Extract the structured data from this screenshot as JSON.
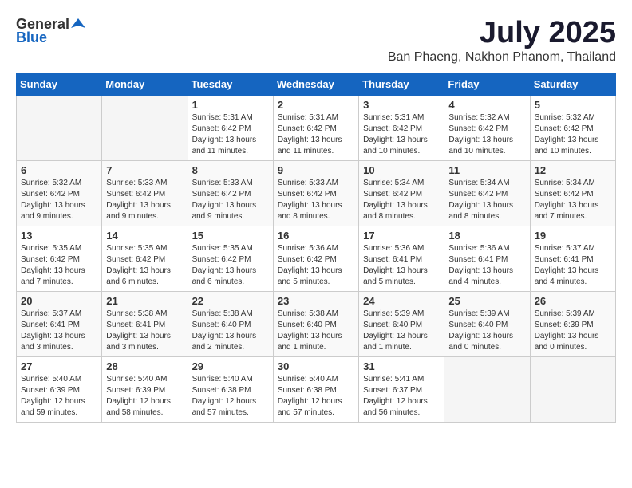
{
  "app": {
    "logo_general": "General",
    "logo_blue": "Blue",
    "title": "July 2025",
    "subtitle": "Ban Phaeng, Nakhon Phanom, Thailand"
  },
  "calendar": {
    "headers": [
      "Sunday",
      "Monday",
      "Tuesday",
      "Wednesday",
      "Thursday",
      "Friday",
      "Saturday"
    ],
    "weeks": [
      [
        {
          "day": "",
          "info": ""
        },
        {
          "day": "",
          "info": ""
        },
        {
          "day": "1",
          "info": "Sunrise: 5:31 AM\nSunset: 6:42 PM\nDaylight: 13 hours and 11 minutes."
        },
        {
          "day": "2",
          "info": "Sunrise: 5:31 AM\nSunset: 6:42 PM\nDaylight: 13 hours and 11 minutes."
        },
        {
          "day": "3",
          "info": "Sunrise: 5:31 AM\nSunset: 6:42 PM\nDaylight: 13 hours and 10 minutes."
        },
        {
          "day": "4",
          "info": "Sunrise: 5:32 AM\nSunset: 6:42 PM\nDaylight: 13 hours and 10 minutes."
        },
        {
          "day": "5",
          "info": "Sunrise: 5:32 AM\nSunset: 6:42 PM\nDaylight: 13 hours and 10 minutes."
        }
      ],
      [
        {
          "day": "6",
          "info": "Sunrise: 5:32 AM\nSunset: 6:42 PM\nDaylight: 13 hours and 9 minutes."
        },
        {
          "day": "7",
          "info": "Sunrise: 5:33 AM\nSunset: 6:42 PM\nDaylight: 13 hours and 9 minutes."
        },
        {
          "day": "8",
          "info": "Sunrise: 5:33 AM\nSunset: 6:42 PM\nDaylight: 13 hours and 9 minutes."
        },
        {
          "day": "9",
          "info": "Sunrise: 5:33 AM\nSunset: 6:42 PM\nDaylight: 13 hours and 8 minutes."
        },
        {
          "day": "10",
          "info": "Sunrise: 5:34 AM\nSunset: 6:42 PM\nDaylight: 13 hours and 8 minutes."
        },
        {
          "day": "11",
          "info": "Sunrise: 5:34 AM\nSunset: 6:42 PM\nDaylight: 13 hours and 8 minutes."
        },
        {
          "day": "12",
          "info": "Sunrise: 5:34 AM\nSunset: 6:42 PM\nDaylight: 13 hours and 7 minutes."
        }
      ],
      [
        {
          "day": "13",
          "info": "Sunrise: 5:35 AM\nSunset: 6:42 PM\nDaylight: 13 hours and 7 minutes."
        },
        {
          "day": "14",
          "info": "Sunrise: 5:35 AM\nSunset: 6:42 PM\nDaylight: 13 hours and 6 minutes."
        },
        {
          "day": "15",
          "info": "Sunrise: 5:35 AM\nSunset: 6:42 PM\nDaylight: 13 hours and 6 minutes."
        },
        {
          "day": "16",
          "info": "Sunrise: 5:36 AM\nSunset: 6:42 PM\nDaylight: 13 hours and 5 minutes."
        },
        {
          "day": "17",
          "info": "Sunrise: 5:36 AM\nSunset: 6:41 PM\nDaylight: 13 hours and 5 minutes."
        },
        {
          "day": "18",
          "info": "Sunrise: 5:36 AM\nSunset: 6:41 PM\nDaylight: 13 hours and 4 minutes."
        },
        {
          "day": "19",
          "info": "Sunrise: 5:37 AM\nSunset: 6:41 PM\nDaylight: 13 hours and 4 minutes."
        }
      ],
      [
        {
          "day": "20",
          "info": "Sunrise: 5:37 AM\nSunset: 6:41 PM\nDaylight: 13 hours and 3 minutes."
        },
        {
          "day": "21",
          "info": "Sunrise: 5:38 AM\nSunset: 6:41 PM\nDaylight: 13 hours and 3 minutes."
        },
        {
          "day": "22",
          "info": "Sunrise: 5:38 AM\nSunset: 6:40 PM\nDaylight: 13 hours and 2 minutes."
        },
        {
          "day": "23",
          "info": "Sunrise: 5:38 AM\nSunset: 6:40 PM\nDaylight: 13 hours and 1 minute."
        },
        {
          "day": "24",
          "info": "Sunrise: 5:39 AM\nSunset: 6:40 PM\nDaylight: 13 hours and 1 minute."
        },
        {
          "day": "25",
          "info": "Sunrise: 5:39 AM\nSunset: 6:40 PM\nDaylight: 13 hours and 0 minutes."
        },
        {
          "day": "26",
          "info": "Sunrise: 5:39 AM\nSunset: 6:39 PM\nDaylight: 13 hours and 0 minutes."
        }
      ],
      [
        {
          "day": "27",
          "info": "Sunrise: 5:40 AM\nSunset: 6:39 PM\nDaylight: 12 hours and 59 minutes."
        },
        {
          "day": "28",
          "info": "Sunrise: 5:40 AM\nSunset: 6:39 PM\nDaylight: 12 hours and 58 minutes."
        },
        {
          "day": "29",
          "info": "Sunrise: 5:40 AM\nSunset: 6:38 PM\nDaylight: 12 hours and 57 minutes."
        },
        {
          "day": "30",
          "info": "Sunrise: 5:40 AM\nSunset: 6:38 PM\nDaylight: 12 hours and 57 minutes."
        },
        {
          "day": "31",
          "info": "Sunrise: 5:41 AM\nSunset: 6:37 PM\nDaylight: 12 hours and 56 minutes."
        },
        {
          "day": "",
          "info": ""
        },
        {
          "day": "",
          "info": ""
        }
      ]
    ]
  }
}
